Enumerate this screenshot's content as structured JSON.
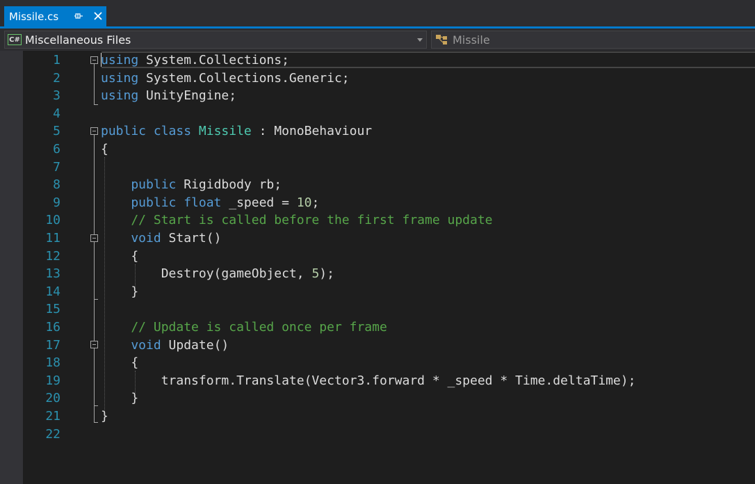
{
  "tab": {
    "title": "Missile.cs",
    "pin_icon": "pin-icon",
    "close_icon": "close-icon"
  },
  "navbar": {
    "project": "Miscellaneous Files",
    "project_badge": "C#",
    "member": "Missile"
  },
  "editor": {
    "lines": [
      {
        "n": "1",
        "t": [
          [
            "kw",
            "using"
          ],
          [
            "",
            "System.Collections;"
          ]
        ]
      },
      {
        "n": "2",
        "t": [
          [
            "kw",
            "using"
          ],
          [
            "",
            "System.Collections.Generic;"
          ]
        ]
      },
      {
        "n": "3",
        "t": [
          [
            "kw",
            "using"
          ],
          [
            "",
            "UnityEngine;"
          ]
        ]
      },
      {
        "n": "4",
        "t": []
      },
      {
        "n": "5",
        "t": [
          [
            "kw",
            "public class"
          ],
          [
            "ty",
            "Missile"
          ],
          [
            "",
            ": MonoBehaviour"
          ]
        ]
      },
      {
        "n": "6",
        "t": [
          [
            "",
            "{"
          ]
        ]
      },
      {
        "n": "7",
        "t": []
      },
      {
        "n": "8",
        "t": [
          [
            "kw",
            "    public"
          ],
          [
            "",
            "Rigidbody rb;"
          ]
        ]
      },
      {
        "n": "9",
        "t": [
          [
            "kw",
            "    public float"
          ],
          [
            "",
            "_speed ="
          ],
          [
            "nm",
            "10"
          ],
          [
            "",
            ";"
          ]
        ]
      },
      {
        "n": "10",
        "t": [
          [
            "cm",
            "    // Start is called before the first frame update"
          ]
        ]
      },
      {
        "n": "11",
        "t": [
          [
            "kw",
            "    void"
          ],
          [
            "",
            "Start()"
          ]
        ]
      },
      {
        "n": "12",
        "t": [
          [
            "",
            "    {"
          ]
        ]
      },
      {
        "n": "13",
        "t": [
          [
            "",
            "        Destroy(gameObject,"
          ],
          [
            "nm",
            "5"
          ],
          [
            "",
            ");"
          ]
        ]
      },
      {
        "n": "14",
        "t": [
          [
            "",
            "    }"
          ]
        ]
      },
      {
        "n": "15",
        "t": []
      },
      {
        "n": "16",
        "t": [
          [
            "cm",
            "    // Update is called once per frame"
          ]
        ]
      },
      {
        "n": "17",
        "t": [
          [
            "kw",
            "    void"
          ],
          [
            "",
            "Update()"
          ]
        ]
      },
      {
        "n": "18",
        "t": [
          [
            "",
            "    {"
          ]
        ]
      },
      {
        "n": "19",
        "t": [
          [
            "",
            "        transform.Translate(Vector3.forward * _speed * Time.deltaTime);"
          ]
        ]
      },
      {
        "n": "20",
        "t": [
          [
            "",
            "    }"
          ]
        ]
      },
      {
        "n": "21",
        "t": [
          [
            "",
            "}"
          ]
        ]
      },
      {
        "n": "22",
        "t": []
      }
    ]
  }
}
